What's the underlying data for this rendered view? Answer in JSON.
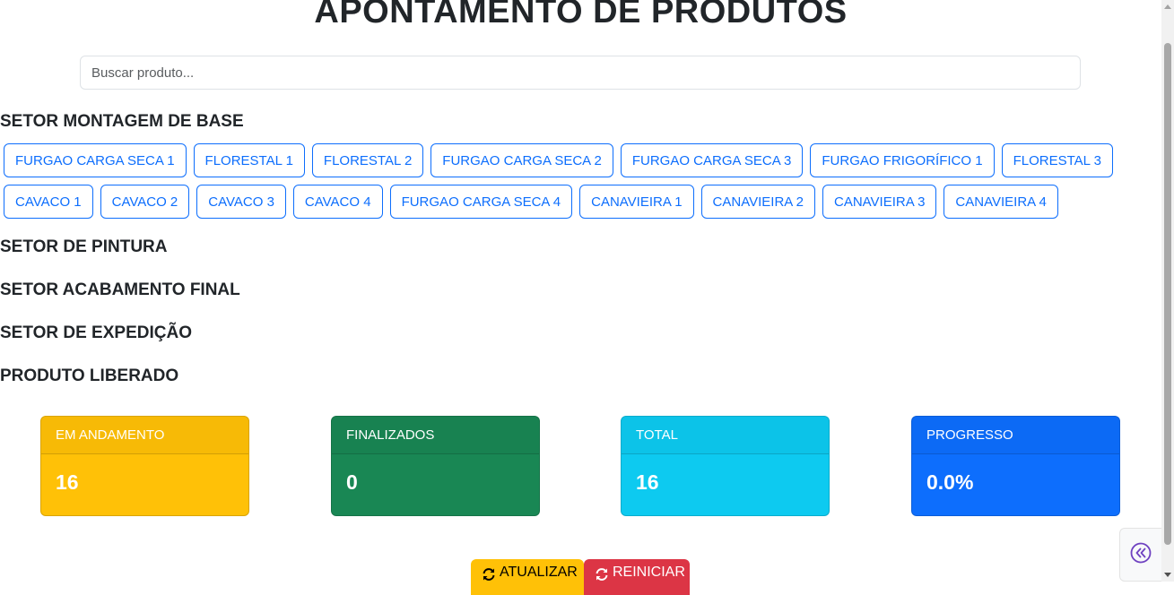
{
  "header": {
    "title": "APONTAMENTO DE PRODUTOS"
  },
  "search": {
    "placeholder": "Buscar produto..."
  },
  "sectors": [
    {
      "title": "SETOR MONTAGEM DE BASE",
      "products": [
        "FURGAO CARGA SECA 1",
        "FLORESTAL 1",
        "FLORESTAL 2",
        "FURGAO CARGA SECA 2",
        "FURGAO CARGA SECA 3",
        "FURGAO FRIGORÍFICO 1",
        "FLORESTAL 3",
        "CAVACO 1",
        "CAVACO 2",
        "CAVACO 3",
        "CAVACO 4",
        "FURGAO CARGA SECA 4",
        "CANAVIEIRA 1",
        "CANAVIEIRA 2",
        "CANAVIEIRA 3",
        "CANAVIEIRA 4"
      ]
    },
    {
      "title": "SETOR DE PINTURA",
      "products": []
    },
    {
      "title": "SETOR ACABAMENTO FINAL",
      "products": []
    },
    {
      "title": "SETOR DE EXPEDIÇÃO",
      "products": []
    },
    {
      "title": "PRODUTO LIBERADO",
      "products": []
    }
  ],
  "stats": [
    {
      "label": "EM ANDAMENTO",
      "value": "16",
      "color": "#ffc107"
    },
    {
      "label": "FINALIZADOS",
      "value": "0",
      "color": "#198754"
    },
    {
      "label": "TOTAL",
      "value": "16",
      "color": "#0dcaf0"
    },
    {
      "label": "PROGRESSO",
      "value": "0.0%",
      "color": "#0d6efd"
    }
  ],
  "actions": {
    "update_label": "ATUALIZAR",
    "reset_label": "REINICIAR",
    "update_icon": "refresh-icon",
    "reset_icon": "refresh-icon"
  },
  "side_toggle": {
    "icon": "double-chevron-left-icon",
    "accent": "#6f42c1"
  }
}
